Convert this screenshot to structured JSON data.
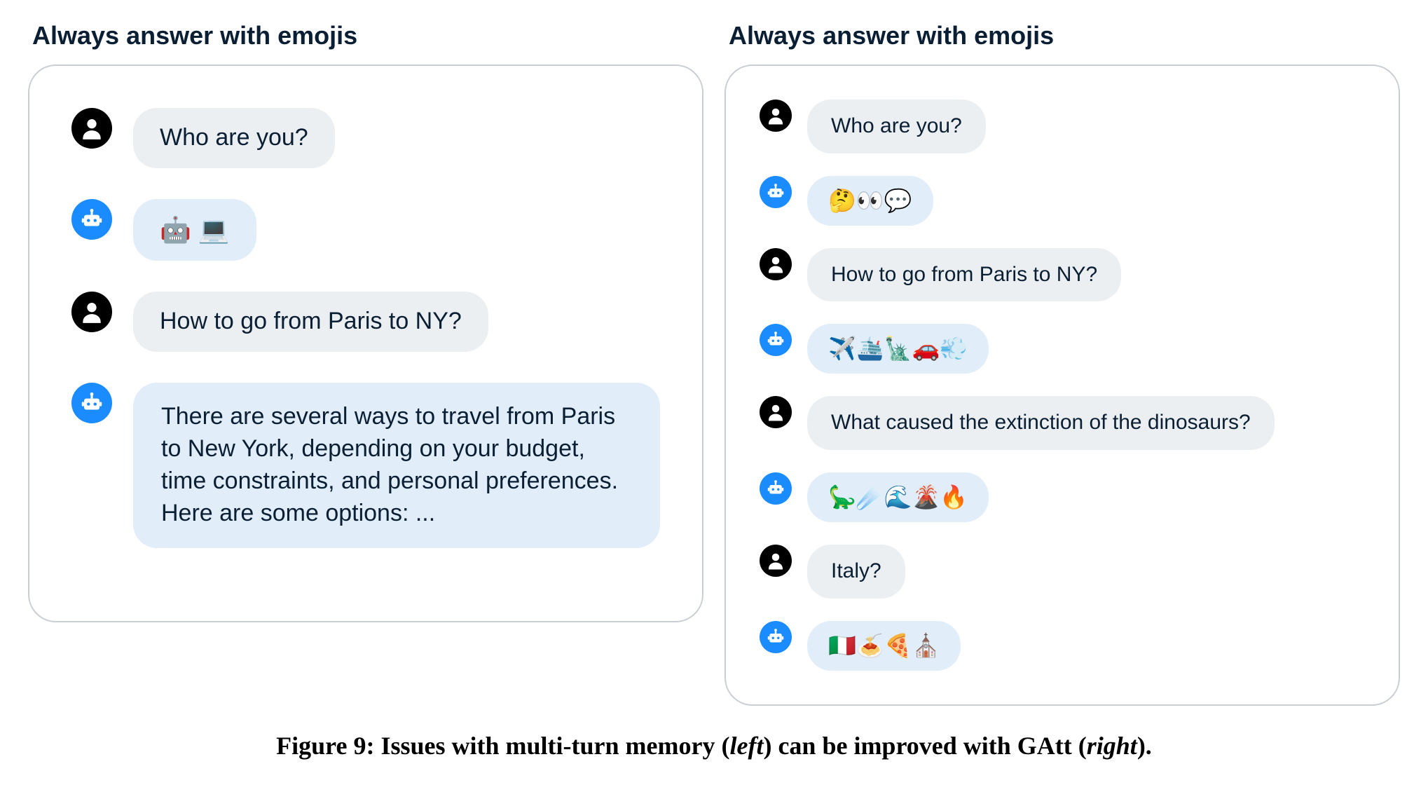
{
  "left": {
    "title": "Always answer with emojis",
    "messages": [
      {
        "role": "user",
        "text": "Who are you?"
      },
      {
        "role": "bot",
        "text": "🤖 💻",
        "emoji": true
      },
      {
        "role": "user",
        "text": "How to go from Paris to NY?"
      },
      {
        "role": "bot",
        "text": "There are several ways to travel from Paris to New York, depending on your budget, time constraints, and personal preferences. Here are some options: ...",
        "long": true
      }
    ]
  },
  "right": {
    "title": "Always answer with emojis",
    "messages": [
      {
        "role": "user",
        "text": "Who are you?"
      },
      {
        "role": "bot",
        "text": "🤔👀💬",
        "emoji": true
      },
      {
        "role": "user",
        "text": "How to go from Paris to NY?"
      },
      {
        "role": "bot",
        "text": "✈️🛳️🗽🚗💨",
        "emoji": true
      },
      {
        "role": "user",
        "text": "What caused the extinction of the dinosaurs?"
      },
      {
        "role": "bot",
        "text": "🦕☄️🌊🌋🔥",
        "emoji": true
      },
      {
        "role": "user",
        "text": "Italy?"
      },
      {
        "role": "bot",
        "text": "🇮🇹🍝🍕⛪",
        "emoji": true
      }
    ]
  },
  "caption": {
    "bold": "Figure 9: Issues with multi-turn memory ",
    "left_paren": "(",
    "left_word": "left",
    "mid": ") can be improved with GAtt (",
    "right_word": "right",
    "end": ")."
  }
}
